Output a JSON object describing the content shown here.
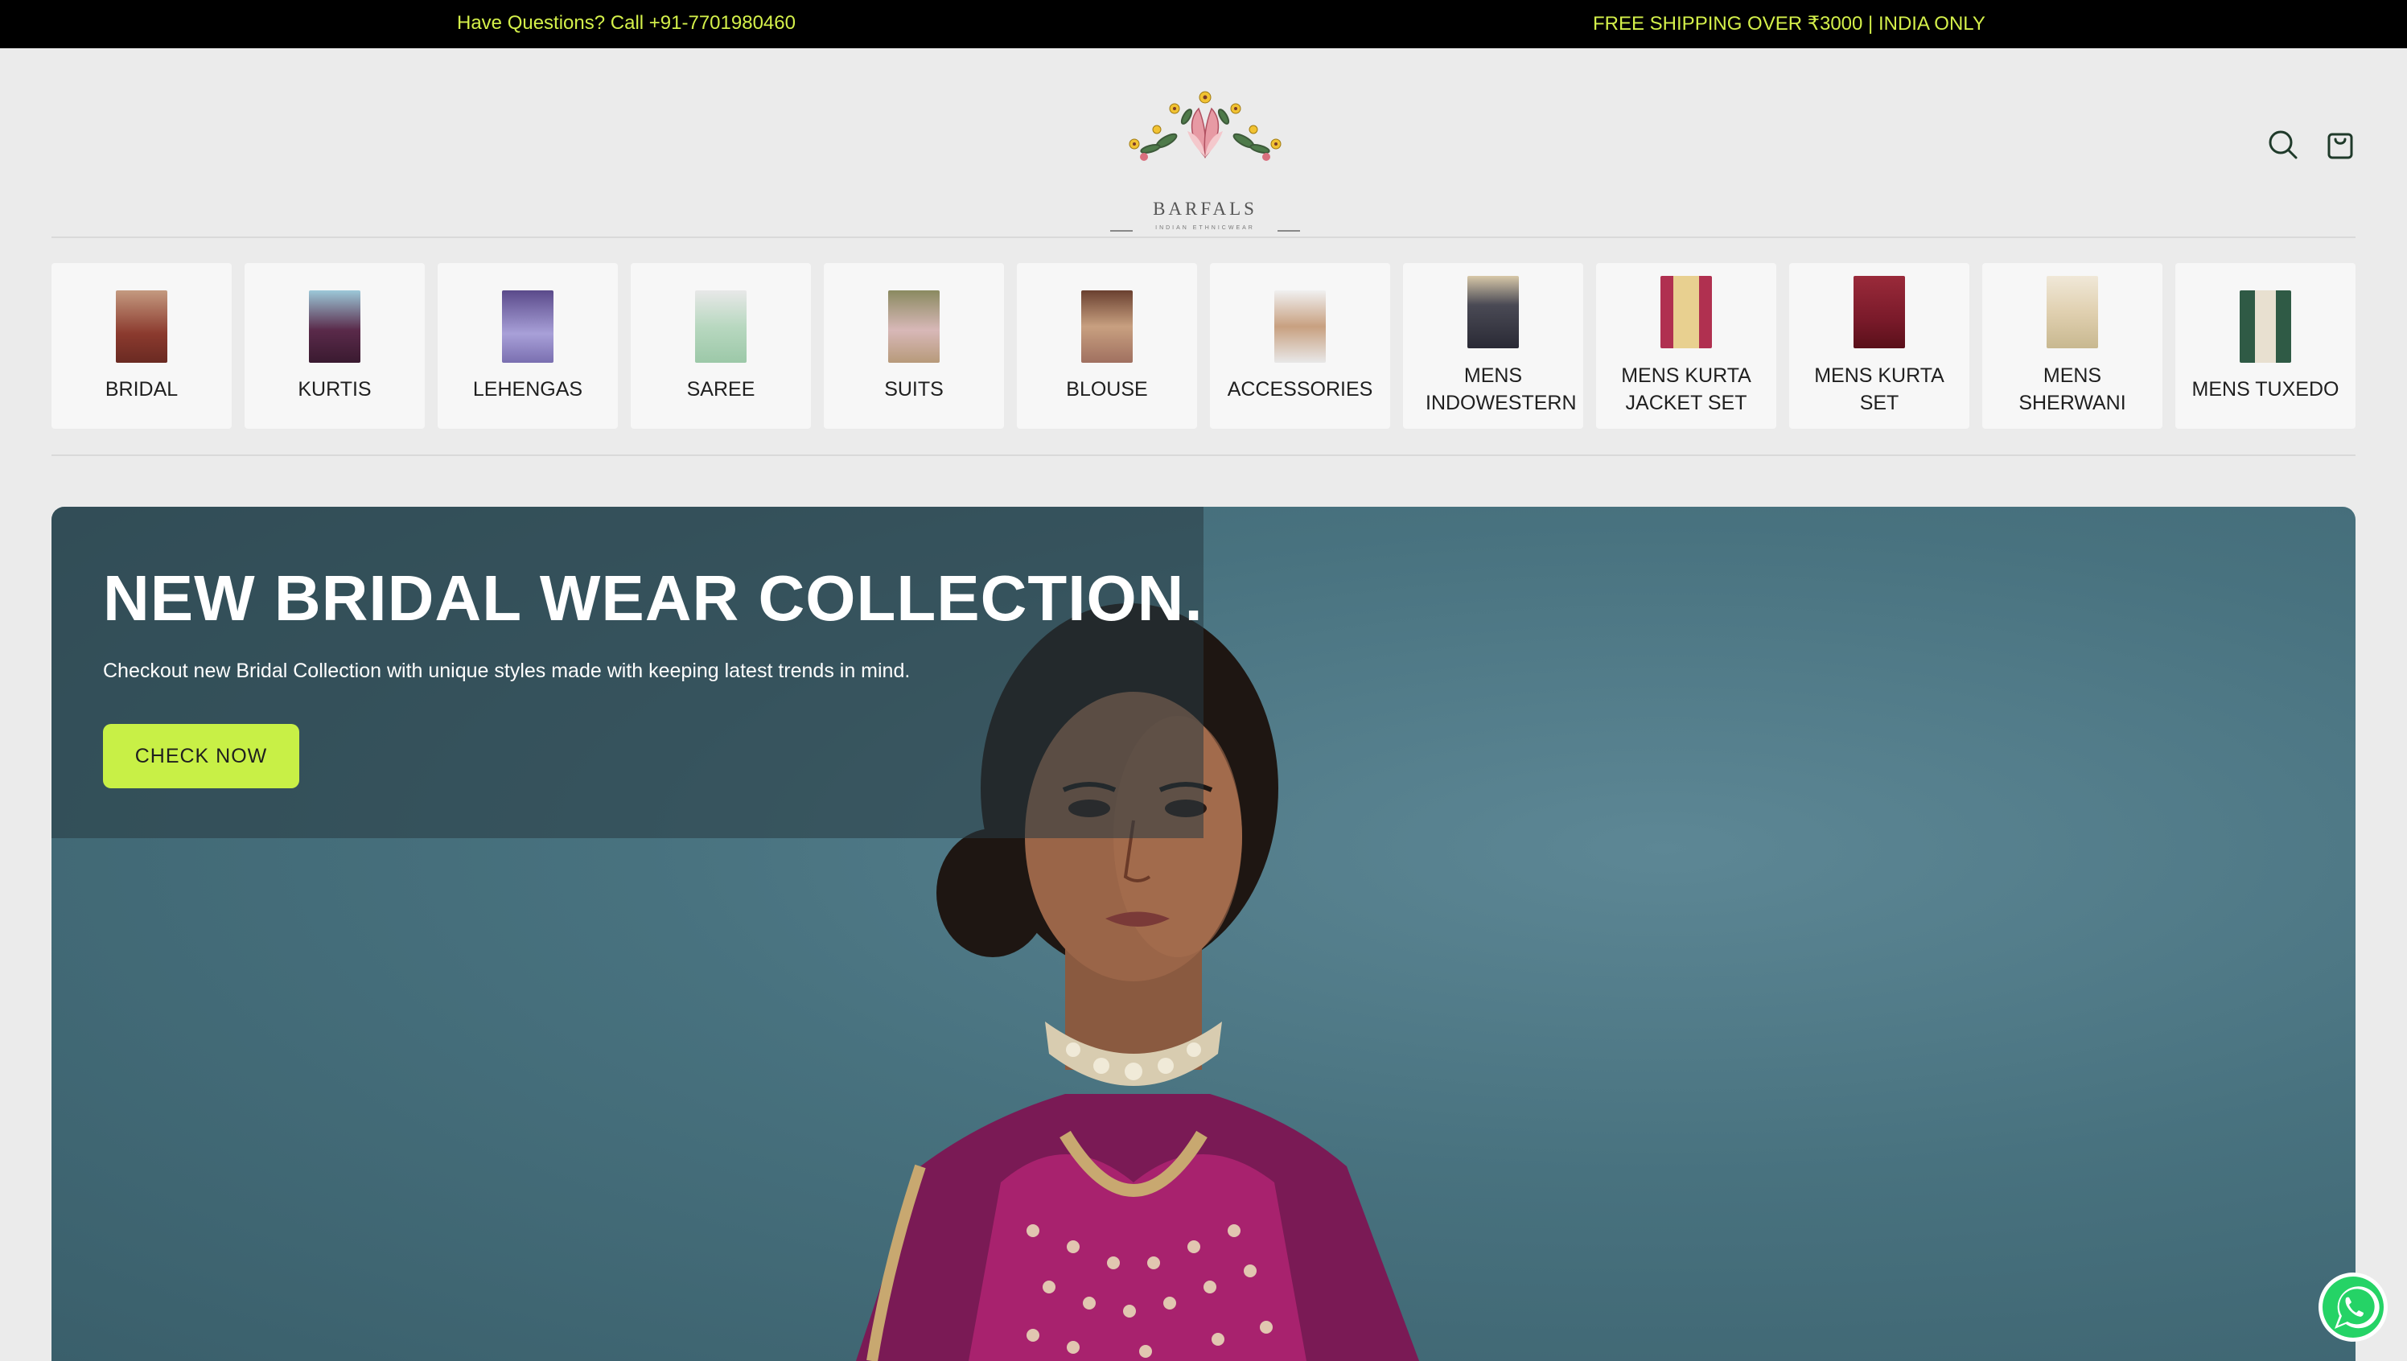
{
  "announcement": {
    "left": "Have Questions? Call +91-7701980460",
    "right": "FREE SHIPPING OVER ₹3000 | INDIA ONLY"
  },
  "header": {
    "logo": {
      "brand": "BARFALS",
      "tagline": "INDIAN ETHNICWEAR"
    },
    "icons": [
      "search-icon",
      "shopping-bag-icon"
    ]
  },
  "categories": [
    {
      "label": "BRIDAL",
      "thumb_color": "#8b3a2e"
    },
    {
      "label": "KURTIS",
      "thumb_color": "#5a2a4a"
    },
    {
      "label": "LEHENGAS",
      "thumb_color": "#7a6fb0"
    },
    {
      "label": "SAREE",
      "thumb_color": "#b8d8c0"
    },
    {
      "label": "SUITS",
      "thumb_color": "#b79a7a"
    },
    {
      "label": "BLOUSE",
      "thumb_color": "#a07060"
    },
    {
      "label": "ACCESSORIES",
      "thumb_color": "#c8a080"
    },
    {
      "label": "MENS INDOWESTERN",
      "thumb_color": "#4a4a55"
    },
    {
      "label": "MENS KURTA JACKET SET",
      "thumb_color": "#b03050"
    },
    {
      "label": "MENS KURTA SET",
      "thumb_color": "#7a1a2a"
    },
    {
      "label": "MENS SHERWANI",
      "thumb_color": "#e0d0b0"
    },
    {
      "label": "MENS TUXEDO",
      "thumb_color": "#2f5a45"
    }
  ],
  "hero": {
    "title": "NEW BRIDAL WEAR COLLECTION.",
    "subtitle": "Checkout new Bridal Collection with unique styles made with keeping latest trends in mind.",
    "cta_label": "CHECK NOW"
  },
  "colors": {
    "accent": "#c8f046",
    "announcement_text": "#d4f04a",
    "hero_bg": "#48727f"
  }
}
